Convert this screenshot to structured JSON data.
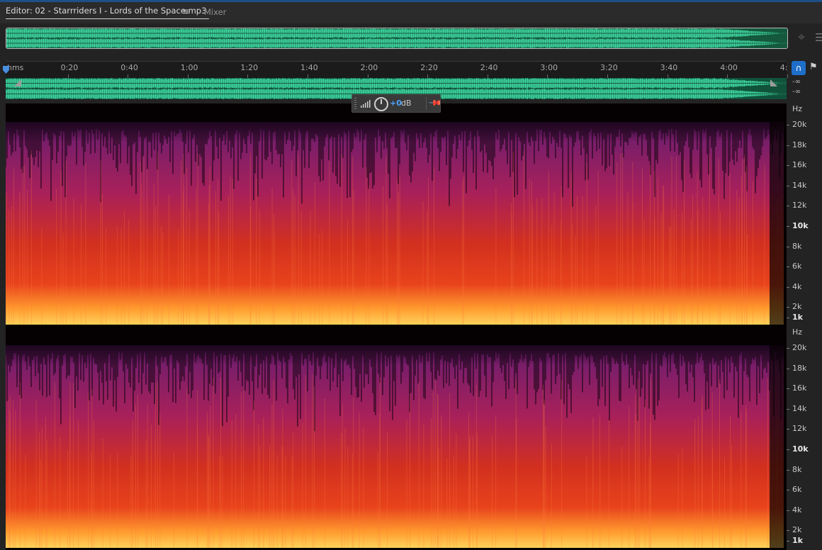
{
  "tabs": {
    "editor_label": "Editor: 02 - Starrriders I - Lords of the Space.mp3",
    "menu_icon": "≡",
    "mixer_label": "Mixer"
  },
  "ruler": {
    "unit": "hms",
    "ticks": [
      "0:20",
      "0:40",
      "1:00",
      "1:20",
      "1:40",
      "2:00",
      "2:20",
      "2:40",
      "3:00",
      "3:20",
      "3:40",
      "4:00",
      "4:"
    ]
  },
  "waveform": {
    "color": "#3fd7a2",
    "channel_levels": [
      "-∞",
      "-∞"
    ]
  },
  "hud": {
    "value": "+0",
    "unit": "dB"
  },
  "spectrogram": {
    "unit": "Hz",
    "freq_labels": [
      "20k",
      "18k",
      "16k",
      "14k",
      "12k",
      "10k",
      "8k",
      "6k",
      "4k",
      "2k",
      "1k"
    ],
    "bold_labels": [
      "10k",
      "1k"
    ],
    "colors": {
      "background": "#050102",
      "low": "#ffd25a",
      "mid": "#e8431c",
      "high": "#7a1e6a",
      "accent": "#1f6ec8"
    }
  },
  "icons": {
    "zoom": "zoom-icon",
    "list": "list-icon",
    "snap": "headphone-snap-icon",
    "marker": "marker-icon",
    "pin": "pin-icon",
    "knob": "volume-knob-icon"
  }
}
